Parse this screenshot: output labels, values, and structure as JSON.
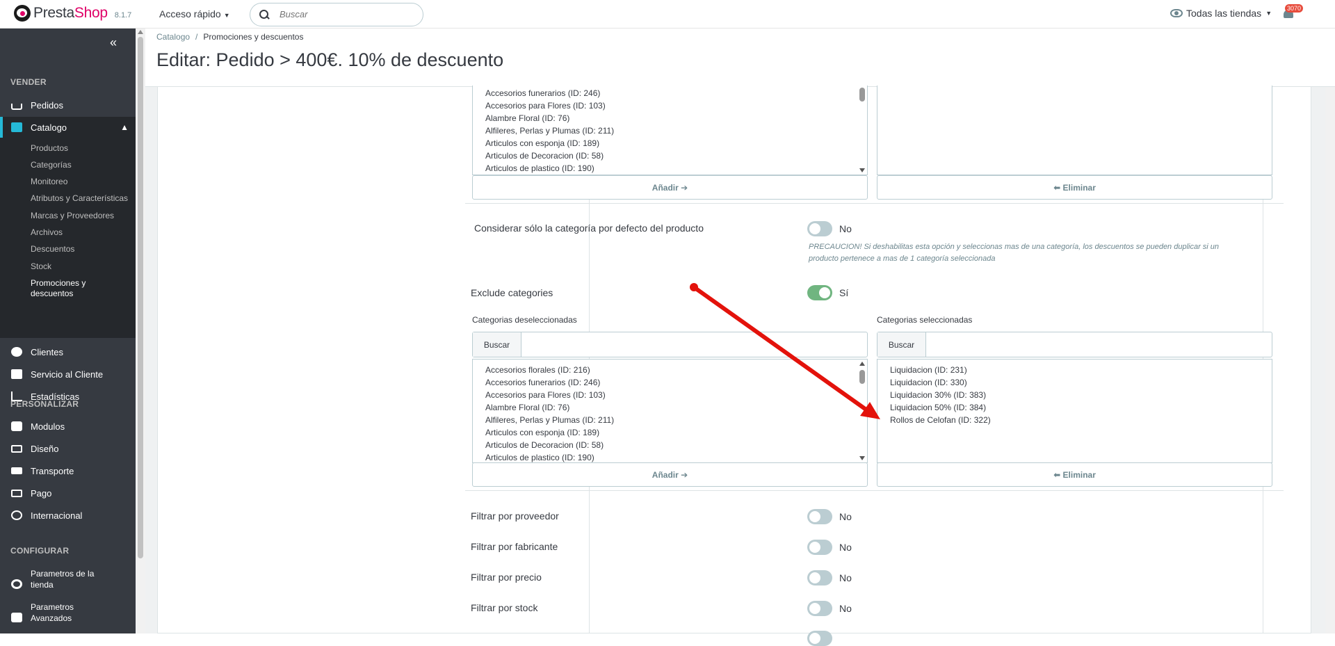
{
  "header": {
    "brand_part1": "Presta",
    "brand_part2": "Shop",
    "version": "8.1.7",
    "quick_access": "Acceso rápido",
    "search_placeholder": "Buscar",
    "shop_selector": "Todas las tiendas",
    "notifications_count": "3070"
  },
  "sidebar": {
    "collapse_icon": "«",
    "sections": {
      "sell": "VENDER",
      "customize": "PERSONALIZAR",
      "configure": "CONFIGURAR"
    },
    "items": {
      "orders": "Pedidos",
      "catalog": "Catalogo",
      "clients": "Clientes",
      "customer_service": "Servicio al Cliente",
      "stats": "Estadísticas",
      "modules": "Modulos",
      "design": "Diseño",
      "shipping": "Transporte",
      "payment": "Pago",
      "international": "Internacional",
      "shop_params_1": "Parametros de la",
      "shop_params_2": "tienda",
      "advanced_params_1": "Parametros",
      "advanced_params_2": "Avanzados"
    },
    "catalog_sub": [
      "Productos",
      "Categorías",
      "Monitoreo",
      "Atributos y Características",
      "Marcas y Proveedores",
      "Archivos",
      "Descuentos",
      "Stock",
      "Promociones y",
      "descuentos"
    ]
  },
  "page": {
    "breadcrumb_1": "Catalogo",
    "breadcrumb_sep": "/",
    "breadcrumb_2": "Promociones y descuentos",
    "title": "Editar: Pedido > 400€. 10% de descuento"
  },
  "form": {
    "top_list_options": [
      "Accesorios funerarios (ID: 246)",
      "Accesorios para Flores (ID: 103)",
      "Alambre Floral (ID: 76)",
      "Alfileres, Perlas y Plumas (ID: 211)",
      "Articulos con esponja (ID: 189)",
      "Articulos de Decoracion (ID: 58)",
      "Articulos de plastico (ID: 190)"
    ],
    "add_button": "Añadir",
    "remove_button": "Eliminar",
    "default_category_label": "Considerar sólo la categoría por defecto del producto",
    "default_category_value": "No",
    "default_category_help_1": "PRECAUCION! Si deshabilitas esta opción y seleccionas mas de una categoría, los descuentos se pueden duplicar si un",
    "default_category_help_2": "producto pertenece a mas de 1 categoría seleccionada",
    "exclude_label": "Exclude categories",
    "exclude_value": "Sí",
    "unselected_label": "Categorias deseleccionadas",
    "selected_label": "Categorias seleccionadas",
    "search_btn": "Buscar",
    "unselected_options": [
      "Accesorios florales (ID: 216)",
      "Accesorios funerarios (ID: 246)",
      "Accesorios para Flores (ID: 103)",
      "Alambre Floral (ID: 76)",
      "Alfileres, Perlas y Plumas (ID: 211)",
      "Articulos con esponja (ID: 189)",
      "Articulos de Decoracion (ID: 58)",
      "Articulos de plastico (ID: 190)"
    ],
    "selected_options": [
      "Liquidacion (ID: 231)",
      "Liquidacion (ID: 330)",
      "Liquidacion 30% (ID: 383)",
      "Liquidacion 50% (ID: 384)",
      "Rollos de Celofan (ID: 322)"
    ],
    "filter_supplier": "Filtrar por proveedor",
    "filter_manufacturer": "Filtrar por fabricante",
    "filter_price": "Filtrar por precio",
    "filter_stock": "Filtrar por stock",
    "no": "No"
  },
  "colors": {
    "accent": "#25b9d7",
    "toggle_on": "#70b580",
    "arrow": "#e3120b"
  }
}
